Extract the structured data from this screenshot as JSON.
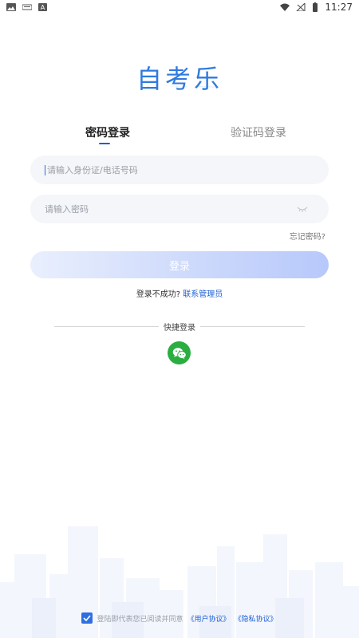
{
  "status_bar": {
    "time": "11:27",
    "left_icons": [
      "image-icon",
      "keyboard-icon",
      "a-icon"
    ],
    "right_icons": [
      "wifi-icon",
      "signal-icon",
      "battery-icon"
    ]
  },
  "logo": {
    "text": "自考乐"
  },
  "tabs": [
    {
      "label": "密码登录",
      "active": true
    },
    {
      "label": "验证码登录",
      "active": false
    }
  ],
  "form": {
    "account_placeholder": "请输入身份证/电话号码",
    "password_placeholder": "请输入密码",
    "forgot_label": "忘记密码?",
    "login_label": "登录"
  },
  "help": {
    "prefix": "登录不成功?",
    "contact": "联系管理员"
  },
  "quick_login": {
    "label": "快捷登录",
    "icon": "wechat-icon"
  },
  "agreement": {
    "checked": true,
    "text": "登陆即代表您已阅读并同意",
    "user_agreement": "《用户协议》",
    "privacy_policy": "《隐私协议》"
  },
  "colors": {
    "accent": "#1d5fd6",
    "logo": "#2f7ae0",
    "wechat": "#2aae3f",
    "button_start": "#e9effd",
    "button_end": "#b7c8fb"
  }
}
